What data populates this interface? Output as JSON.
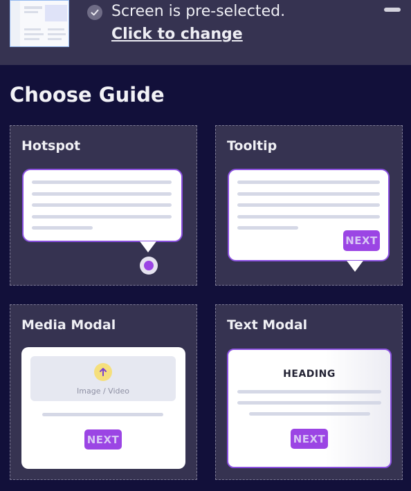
{
  "top_bar": {
    "status_text": "Screen is pre-selected.",
    "change_link": "Click to change"
  },
  "main": {
    "heading": "Choose Guide"
  },
  "guides": [
    {
      "title": "Hotspot"
    },
    {
      "title": "Tooltip",
      "button": "NEXT"
    },
    {
      "title": "Media Modal",
      "media_label": "Image / Video",
      "button": "NEXT"
    },
    {
      "title": "Text Modal",
      "heading": "HEADING",
      "button": "NEXT"
    }
  ],
  "colors": {
    "background": "#12103a",
    "panel": "#363351",
    "accent": "#9b45e4",
    "border_accent": "#8a4fe0"
  }
}
